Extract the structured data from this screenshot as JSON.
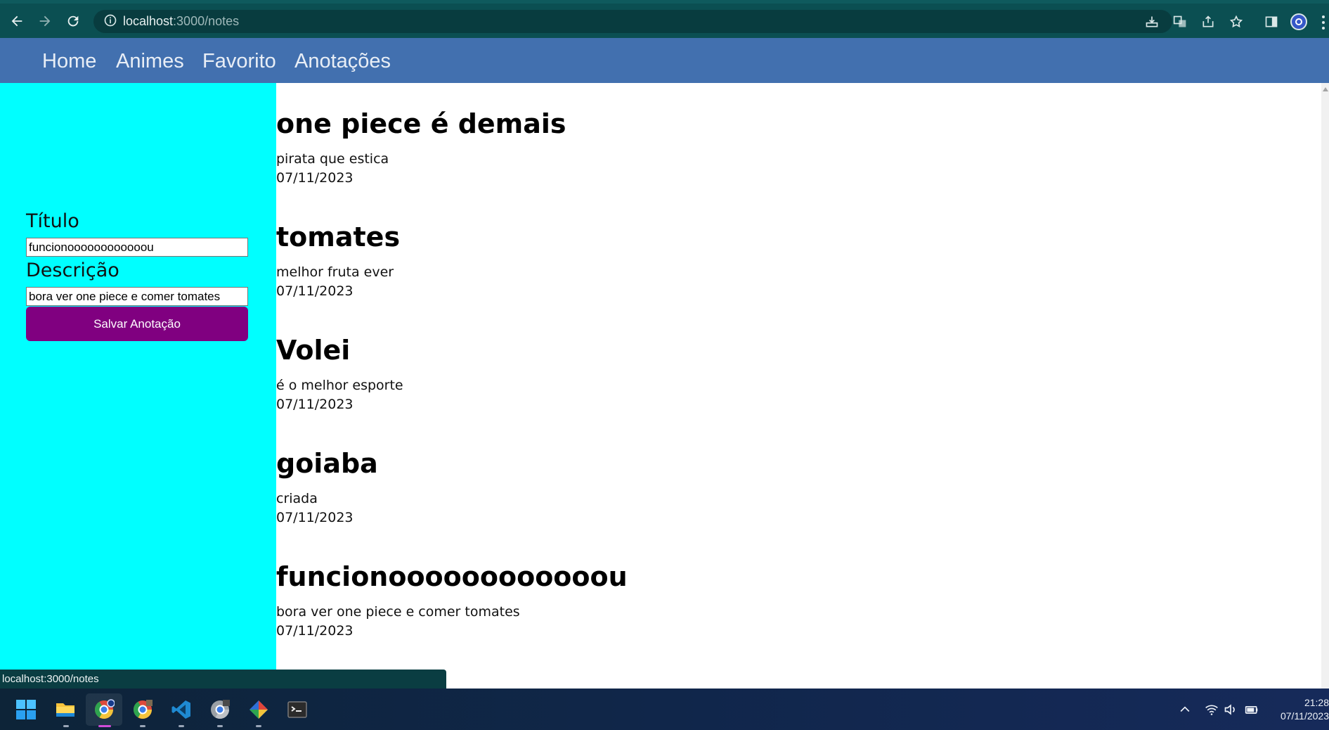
{
  "browser": {
    "url_host": "localhost",
    "url_path": ":3000/notes",
    "status_url": "localhost:3000/notes"
  },
  "nav": {
    "links": [
      "Home",
      "Animes",
      "Favorito",
      "Anotações"
    ]
  },
  "form": {
    "title_label": "Título",
    "title_value": "funcionoooooooooooou",
    "description_label": "Descrição",
    "description_value": " bora ver one piece e comer tomates",
    "save_label": "Salvar Anotação"
  },
  "notes": [
    {
      "title": "one piece é demais",
      "description": "pirata que estica",
      "date": "07/11/2023"
    },
    {
      "title": "tomates",
      "description": "melhor fruta ever",
      "date": "07/11/2023"
    },
    {
      "title": "Volei",
      "description": "é o melhor esporte",
      "date": "07/11/2023"
    },
    {
      "title": "goiaba",
      "description": "criada",
      "date": "07/11/2023"
    },
    {
      "title": "funcionoooooooooooou",
      "description": "bora ver one piece e comer tomates",
      "date": "07/11/2023"
    }
  ],
  "taskbar": {
    "time": "21:28",
    "date": "07/11/2023"
  },
  "colors": {
    "sidebar": "#00ffff",
    "nav": "#4270af",
    "save_button": "#800080",
    "browser_toolbar": "#0b4f52"
  }
}
